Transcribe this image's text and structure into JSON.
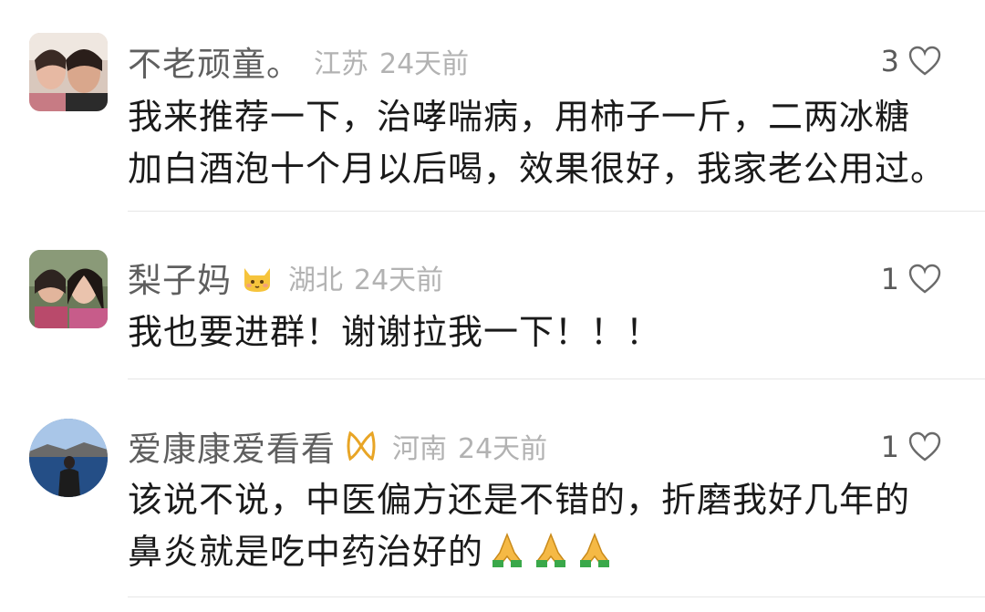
{
  "comments": [
    {
      "username": "不老顽童。",
      "location": "江苏",
      "time": "24天前",
      "likes": "3",
      "text_lines": [
        "我来推荐一下，治哮喘病，用柿子一斤，二两冰糖",
        "加白酒泡十个月以后喝，效果很好，我家老公用过。"
      ],
      "avatar": "avatar-photo-two-women"
    },
    {
      "username": "梨子妈",
      "badge": "cat-emoji",
      "location": "湖北",
      "time": "24天前",
      "likes": "1",
      "text_lines": [
        "我也要进群！谢谢拉我一下！！！"
      ],
      "avatar": "avatar-photo-two-women-selfie"
    },
    {
      "username": "爱康康爱看看",
      "badge": "gold-badge-icon",
      "location": "河南",
      "time": "24天前",
      "likes": "1",
      "text_lines": [
        "该说不说，中医偏方还是不错的，折磨我好几年的",
        "鼻炎就是吃中药治好的"
      ],
      "trailing_emoji": "praying-hands-emoji x3",
      "avatar": "avatar-photo-man-lake"
    }
  ],
  "colors": {
    "username": "#5f5f5f",
    "meta": "#b2b2b2",
    "text": "#1a1a1a",
    "divider": "#e6e6e6"
  }
}
